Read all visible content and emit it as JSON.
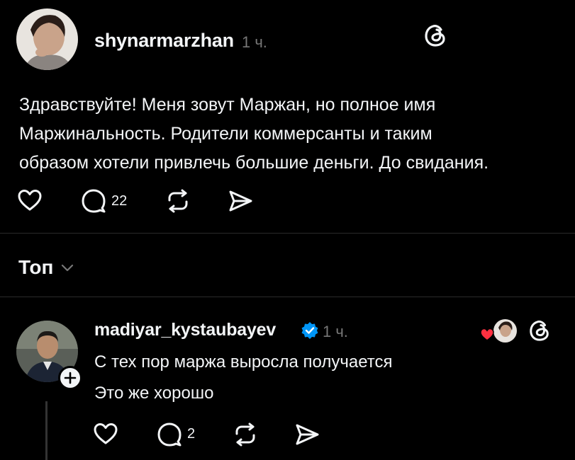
{
  "post": {
    "username": "shynarmarzhan",
    "time": "1 ч.",
    "text_lines": [
      "Здравствуйте! Меня зовут Маржан, но полное имя",
      "Маржинальность. Родители коммерсанты и таким",
      "образом хотели привлечь большие деньги. До свидания."
    ],
    "replies_count": "22",
    "icons": [
      "threads-logo-icon",
      "heart-icon",
      "comment-icon",
      "repost-icon",
      "share-icon"
    ]
  },
  "sort": {
    "label": "Топ"
  },
  "reply": {
    "username": "madiyar_kystaubayev",
    "verified": true,
    "time": "1 ч.",
    "text_lines": [
      "С тех пор маржа выросла получается",
      "Это же хорошо"
    ],
    "replies_count": "2",
    "colors": {
      "verified": "#0095f6",
      "liked_heart": "#ff3040"
    }
  }
}
